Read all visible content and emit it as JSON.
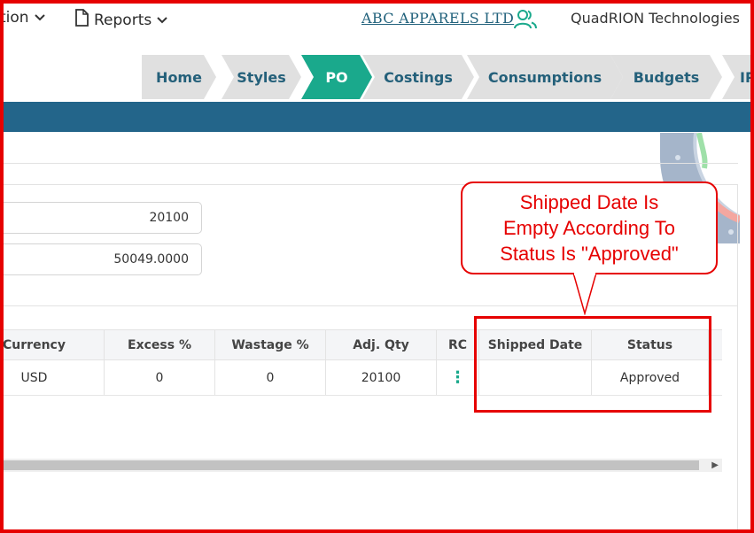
{
  "topbar": {
    "menu_partial": "tion",
    "reports_label": "Reports",
    "company_link": "ABC APPARELS LTD",
    "vendor_name": "QuadRION Technologies",
    "icons": {
      "menu_chevron": "chevron-down-icon",
      "reports": "document-icon",
      "users": "users-icon"
    }
  },
  "nav": {
    "tabs": [
      {
        "label": "Home"
      },
      {
        "label": "Styles"
      },
      {
        "label": "PO",
        "active": true
      },
      {
        "label": "Costings"
      },
      {
        "label": "Consumptions"
      },
      {
        "label": "Budgets"
      },
      {
        "label": "IP"
      }
    ]
  },
  "fields": {
    "qty_value": "20100",
    "amount_value": "50049.0000"
  },
  "table": {
    "columns": [
      "Currency",
      "Excess %",
      "Wastage %",
      "Adj. Qty",
      "RC",
      "Shipped Date",
      "Status"
    ],
    "rows": [
      {
        "currency": "USD",
        "excess": "0",
        "wastage": "0",
        "adj_qty": "20100",
        "rc": "⋮",
        "shipped_date": "",
        "status": "Approved"
      }
    ]
  },
  "annotation": {
    "lines": [
      "Shipped Date Is",
      "Empty According To",
      "Status Is \"Approved\""
    ]
  },
  "colors": {
    "accent": "#1aa98c",
    "brand_blue": "#23658a",
    "annotation_red": "#e60000",
    "tab_gray": "#e0e0e0"
  }
}
